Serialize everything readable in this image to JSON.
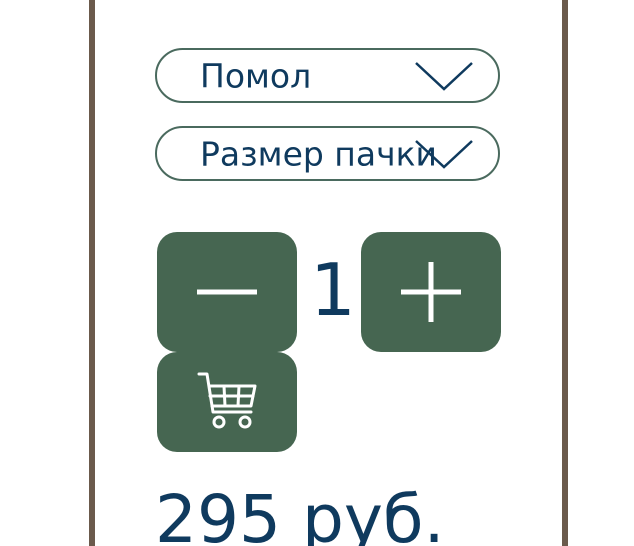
{
  "selects": {
    "grind": {
      "label": "Помол"
    },
    "pack_size": {
      "label": "Размер пачки"
    }
  },
  "quantity": {
    "value": "1",
    "minus_icon": "minus-icon",
    "plus_icon": "plus-icon"
  },
  "cart": {
    "icon": "cart-icon"
  },
  "price": {
    "text": "295 руб."
  },
  "colors": {
    "accent": "#466651",
    "text": "#0f3a5e",
    "border": "#4a6a5e",
    "frame": "#6b5a4c"
  }
}
